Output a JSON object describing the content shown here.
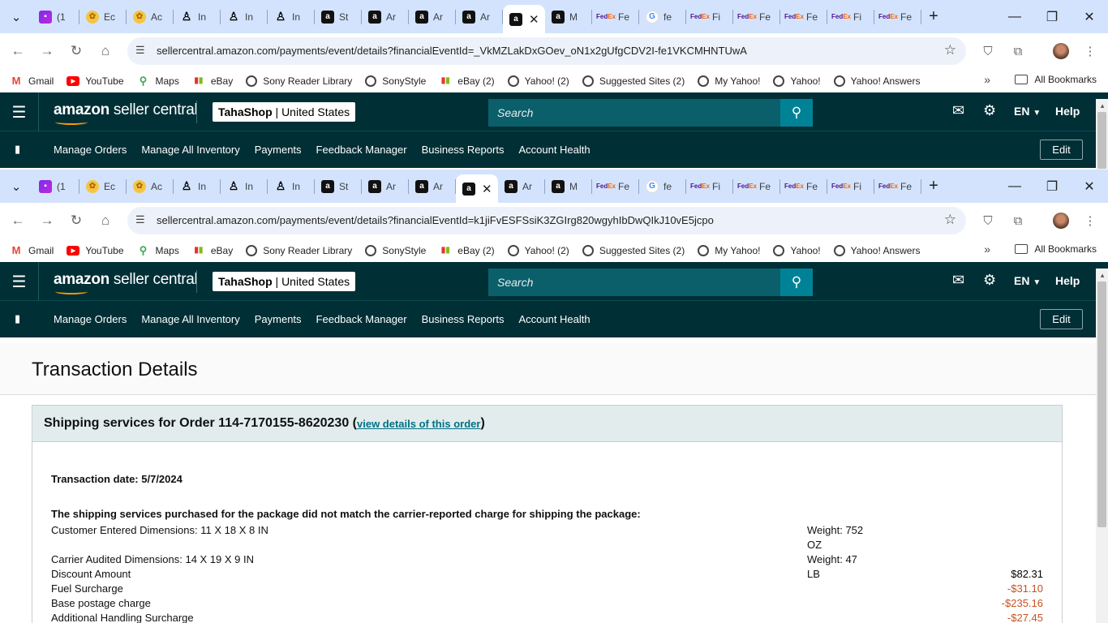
{
  "browser": {
    "tabs_a": [
      {
        "title": "(1",
        "icon": "mail"
      },
      {
        "title": "Ec",
        "icon": "etsy"
      },
      {
        "title": "Ac",
        "icon": "etsy"
      },
      {
        "title": "In",
        "icon": "ink"
      },
      {
        "title": "In",
        "icon": "ink"
      },
      {
        "title": "In",
        "icon": "ink"
      },
      {
        "title": "St",
        "icon": "amz"
      },
      {
        "title": "Ar",
        "icon": "amz"
      },
      {
        "title": "Ar",
        "icon": "amz"
      },
      {
        "title": "Ar",
        "icon": "amz"
      },
      {
        "title": "",
        "icon": "amz",
        "active": true
      },
      {
        "title": "M",
        "icon": "amz"
      },
      {
        "title": "Fe",
        "icon": "fedex"
      },
      {
        "title": "fe",
        "icon": "google"
      },
      {
        "title": "Fi",
        "icon": "fedex"
      },
      {
        "title": "Fe",
        "icon": "fedex"
      },
      {
        "title": "Fe",
        "icon": "fedex"
      },
      {
        "title": "Fi",
        "icon": "fedex"
      },
      {
        "title": "Fe",
        "icon": "fedex"
      }
    ],
    "tabs_b": [
      {
        "title": "(1",
        "icon": "mail"
      },
      {
        "title": "Ec",
        "icon": "etsy"
      },
      {
        "title": "Ac",
        "icon": "etsy"
      },
      {
        "title": "In",
        "icon": "ink"
      },
      {
        "title": "In",
        "icon": "ink"
      },
      {
        "title": "In",
        "icon": "ink"
      },
      {
        "title": "St",
        "icon": "amz"
      },
      {
        "title": "Ar",
        "icon": "amz"
      },
      {
        "title": "Ar",
        "icon": "amz"
      },
      {
        "title": "",
        "icon": "amz",
        "active": true
      },
      {
        "title": "Ar",
        "icon": "amz"
      },
      {
        "title": "M",
        "icon": "amz"
      },
      {
        "title": "Fe",
        "icon": "fedex"
      },
      {
        "title": "fe",
        "icon": "google"
      },
      {
        "title": "Fi",
        "icon": "fedex"
      },
      {
        "title": "Fe",
        "icon": "fedex"
      },
      {
        "title": "Fe",
        "icon": "fedex"
      },
      {
        "title": "Fi",
        "icon": "fedex"
      },
      {
        "title": "Fe",
        "icon": "fedex"
      }
    ],
    "url_a": "sellercentral.amazon.com/payments/event/details?financialEventId=_VkMZLakDxGOev_oN1x2gUfgCDV2I-fe1VKCMHNTUwA",
    "url_b": "sellercentral.amazon.com/payments/event/details?financialEventId=k1jiFvESFSsiK3ZGIrg820wgyhIbDwQIkJ10vE5jcpo",
    "bookmarks": [
      {
        "label": "Gmail",
        "icon": "gmail"
      },
      {
        "label": "YouTube",
        "icon": "youtube"
      },
      {
        "label": "Maps",
        "icon": "maps"
      },
      {
        "label": "eBay",
        "icon": "ebay"
      },
      {
        "label": "Sony Reader Library",
        "icon": "globe"
      },
      {
        "label": "SonyStyle",
        "icon": "globe"
      },
      {
        "label": "eBay (2)",
        "icon": "ebay"
      },
      {
        "label": "Yahoo! (2)",
        "icon": "globe"
      },
      {
        "label": "Suggested Sites (2)",
        "icon": "globe"
      },
      {
        "label": "My Yahoo!",
        "icon": "globe"
      },
      {
        "label": "Yahoo!",
        "icon": "globe"
      },
      {
        "label": "Yahoo! Answers",
        "icon": "globe"
      }
    ],
    "all_bookmarks": "All Bookmarks",
    "new_tab": "+"
  },
  "seller": {
    "logo_bold": "amazon",
    "logo_rest": " seller central",
    "store_name": "TahaShop",
    "store_sep": " | ",
    "store_region": "United States",
    "search_placeholder": "Search",
    "lang": "EN",
    "help": "Help",
    "nav": [
      "Manage Orders",
      "Manage All Inventory",
      "Payments",
      "Feedback Manager",
      "Business Reports",
      "Account Health"
    ],
    "edit": "Edit"
  },
  "page": {
    "title": "Transaction Details",
    "card_title": "Shipping services for Order 114-7170155-8620230",
    "order_link": "view details of this order",
    "paren_open": " (",
    "paren_close": ")",
    "transaction_date": "Transaction date: 5/7/2024",
    "mismatch_note": "The shipping services purchased for the package did not match the carrier-reported charge for shipping the package:",
    "customer_dims": "Customer Entered Dimensions: 11 X 18 X 8 IN",
    "customer_weight": "Weight: 752 OZ",
    "carrier_dims": "Carrier Audited Dimensions: 14 X 19 X 9 IN",
    "carrier_weight": "Weight: 47 LB",
    "lines": [
      {
        "label": "Discount Amount",
        "amount": "$82.31",
        "negative": false
      },
      {
        "label": "Fuel Surcharge",
        "amount": "-$31.10",
        "negative": true
      },
      {
        "label": "Base postage charge",
        "amount": "-$235.16",
        "negative": true
      },
      {
        "label": "Additional Handling Surcharge",
        "amount": "-$27.45",
        "negative": true
      }
    ]
  }
}
